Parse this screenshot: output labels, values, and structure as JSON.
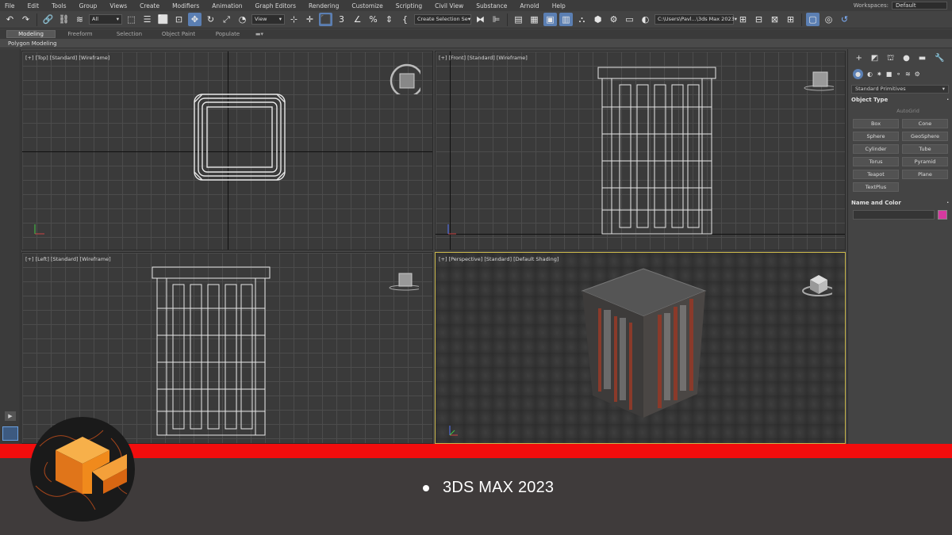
{
  "menu": [
    "File",
    "Edit",
    "Tools",
    "Group",
    "Views",
    "Create",
    "Modifiers",
    "Animation",
    "Graph Editors",
    "Rendering",
    "Customize",
    "Scripting",
    "Civil View",
    "Substance",
    "Arnold",
    "Help"
  ],
  "workspaces": {
    "label": "Workspaces:",
    "value": "Default"
  },
  "toolbar": {
    "filter_value": "All",
    "refcoord_value": "View",
    "selection_set_value": "Create Selection Se",
    "path_value": "C:\\Users\\Pavl...\\3ds Max 2023"
  },
  "ribbon": {
    "tabs": [
      "Modeling",
      "Freeform",
      "Selection",
      "Object Paint",
      "Populate"
    ],
    "selected": "Modeling",
    "sub_label": "Polygon Modeling"
  },
  "viewports": {
    "top": "[+] [Top] [Standard] [Wireframe]",
    "front": "[+] [Front] [Standard] [Wireframe]",
    "left": "[+] [Left] [Standard] [Wireframe]",
    "persp": "[+] [Perspective] [Standard] [Default Shading]"
  },
  "command_panel": {
    "category": "Standard Primitives",
    "object_type_title": "Object Type",
    "autogrid": "AutoGrid",
    "buttons": [
      "Box",
      "Cone",
      "Sphere",
      "GeoSphere",
      "Cylinder",
      "Tube",
      "Torus",
      "Pyramid",
      "Teapot",
      "Plane",
      "TextPlus"
    ],
    "name_color_title": "Name and Color",
    "object_color": "#d63aa0"
  },
  "footer": {
    "text": "3DS MAX 2023"
  },
  "colors": {
    "accent_red": "#f20d0d",
    "logo_orange": "#f08a1c",
    "active_blue": "#5b7fb3"
  }
}
